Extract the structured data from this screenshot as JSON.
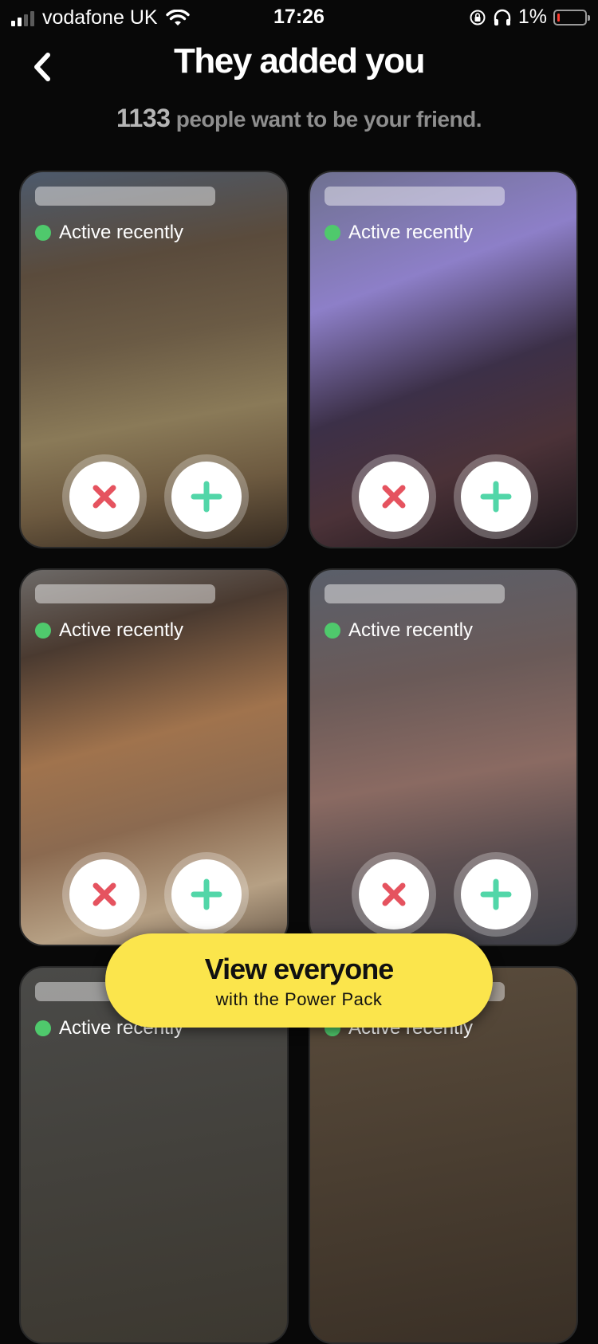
{
  "status_bar": {
    "carrier": "vodafone UK",
    "time": "17:26",
    "battery_percent": "1%",
    "signal_bars_active": 2,
    "signal_bars_total": 4
  },
  "header": {
    "title": "They added you",
    "subtitle_count": "1133",
    "subtitle_text": "people want to be your friend."
  },
  "cards": [
    {
      "status": "Active recently"
    },
    {
      "status": "Active recently"
    },
    {
      "status": "Active recently"
    },
    {
      "status": "Active recently"
    },
    {
      "status": "Active recently"
    },
    {
      "status": "Active recently"
    }
  ],
  "cta": {
    "label": "View everyone",
    "sublabel": "with the Power Pack"
  },
  "colors": {
    "background": "#080808",
    "accent_yellow": "#fbe54c",
    "reject_red": "#e5535f",
    "add_green": "#52d6a8",
    "active_dot": "#4fc96c"
  }
}
